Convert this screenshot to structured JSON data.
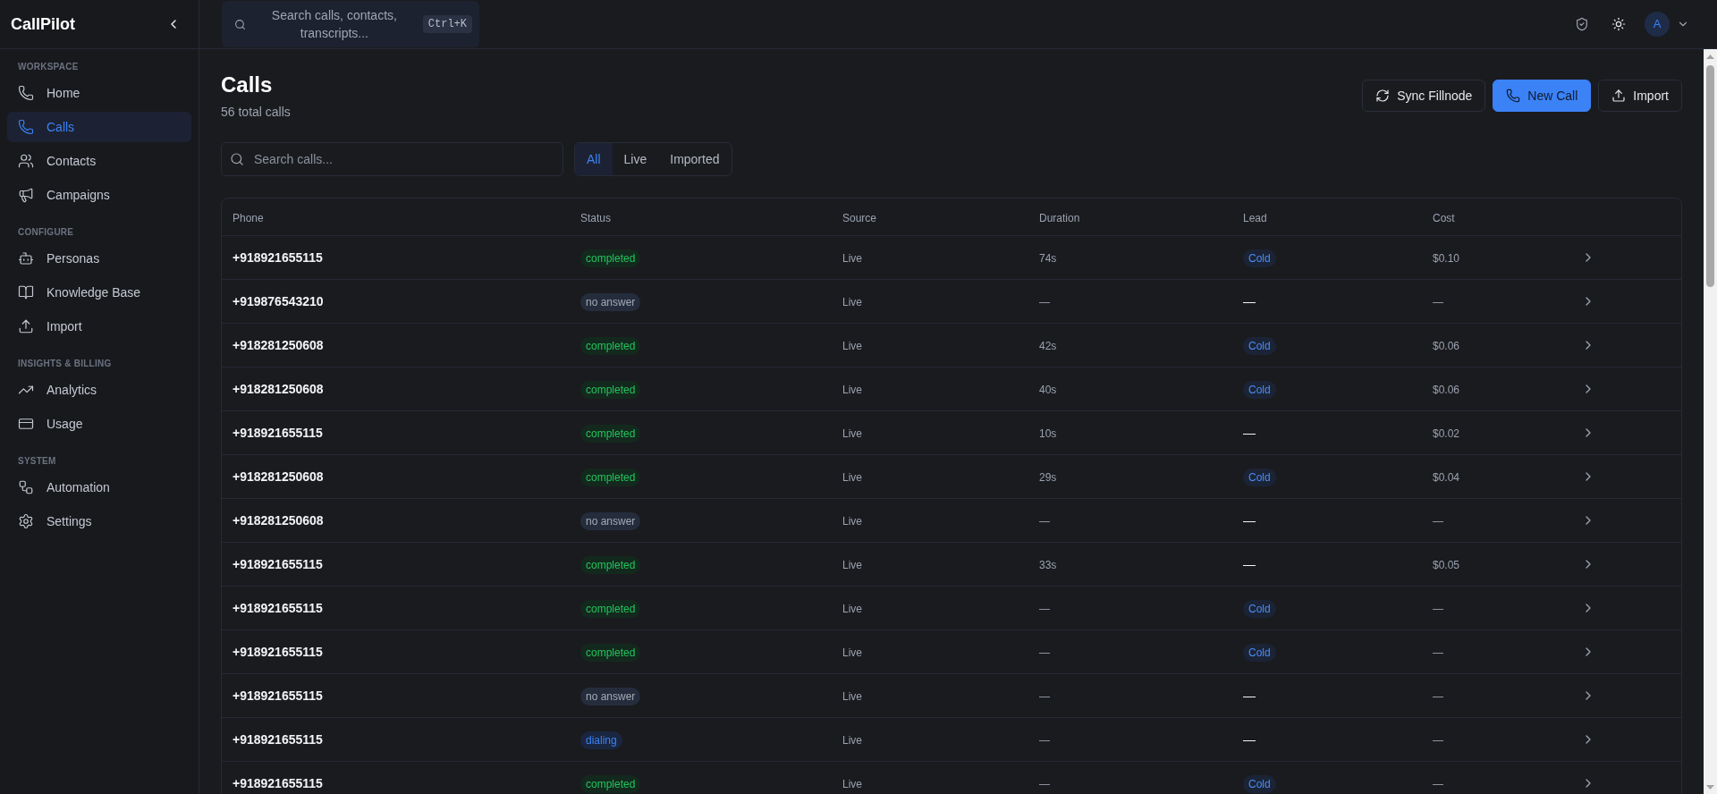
{
  "sidebar": {
    "brand": "CallPilot",
    "sections": [
      {
        "label": "WORKSPACE",
        "items": [
          {
            "label": "Home",
            "selected": false
          },
          {
            "label": "Calls",
            "selected": true
          },
          {
            "label": "Contacts",
            "selected": false
          },
          {
            "label": "Campaigns",
            "selected": false
          }
        ]
      },
      {
        "label": "CONFIGURE",
        "items": [
          {
            "label": "Personas",
            "selected": false
          },
          {
            "label": "Knowledge Base",
            "selected": false
          },
          {
            "label": "Import",
            "selected": false
          }
        ]
      },
      {
        "label": "INSIGHTS & BILLING",
        "items": [
          {
            "label": "Analytics",
            "selected": false
          },
          {
            "label": "Usage",
            "selected": false
          }
        ]
      },
      {
        "label": "SYSTEM",
        "items": [
          {
            "label": "Automation",
            "selected": false
          },
          {
            "label": "Settings",
            "selected": false
          }
        ]
      }
    ]
  },
  "topbar": {
    "search": {
      "label": "Search calls, contacts, transcripts...",
      "shortcut": "Ctrl+K"
    },
    "avatar": "A"
  },
  "header": {
    "title": "Calls",
    "subtitle": "56 total calls",
    "actions": [
      {
        "label": "Sync Fillnode",
        "kind": "outline"
      },
      {
        "label": "New Call",
        "kind": "primary"
      },
      {
        "label": "Import",
        "kind": "outline"
      }
    ]
  },
  "filters": {
    "search": {
      "placeholder": "Search calls..."
    },
    "tabs": [
      {
        "label": "All",
        "selected": true
      },
      {
        "label": "Live",
        "selected": false
      },
      {
        "label": "Imported",
        "selected": false
      }
    ]
  },
  "table": {
    "columns": [
      "Phone",
      "Status",
      "Source",
      "Duration",
      "Lead",
      "Cost"
    ],
    "rows": [
      {
        "phone": "+918921655115",
        "status": {
          "label": "completed",
          "kind": "success"
        },
        "source": "Live",
        "duration": "74s",
        "lead": {
          "label": "Cold",
          "kind": "tag"
        },
        "cost": "$0.10"
      },
      {
        "phone": "+919876543210",
        "status": {
          "label": "no answer",
          "kind": "neutral"
        },
        "source": "Live",
        "duration": "—",
        "lead": {
          "label": "—",
          "kind": "empty"
        },
        "cost": "—"
      },
      {
        "phone": "+918281250608",
        "status": {
          "label": "completed",
          "kind": "success"
        },
        "source": "Live",
        "duration": "42s",
        "lead": {
          "label": "Cold",
          "kind": "tag"
        },
        "cost": "$0.06"
      },
      {
        "phone": "+918281250608",
        "status": {
          "label": "completed",
          "kind": "success"
        },
        "source": "Live",
        "duration": "40s",
        "lead": {
          "label": "Cold",
          "kind": "tag"
        },
        "cost": "$0.06"
      },
      {
        "phone": "+918921655115",
        "status": {
          "label": "completed",
          "kind": "success"
        },
        "source": "Live",
        "duration": "10s",
        "lead": {
          "label": "—",
          "kind": "empty"
        },
        "cost": "$0.02"
      },
      {
        "phone": "+918281250608",
        "status": {
          "label": "completed",
          "kind": "success"
        },
        "source": "Live",
        "duration": "29s",
        "lead": {
          "label": "Cold",
          "kind": "tag"
        },
        "cost": "$0.04"
      },
      {
        "phone": "+918281250608",
        "status": {
          "label": "no answer",
          "kind": "neutral"
        },
        "source": "Live",
        "duration": "—",
        "lead": {
          "label": "—",
          "kind": "empty"
        },
        "cost": "—"
      },
      {
        "phone": "+918921655115",
        "status": {
          "label": "completed",
          "kind": "success"
        },
        "source": "Live",
        "duration": "33s",
        "lead": {
          "label": "—",
          "kind": "empty"
        },
        "cost": "$0.05"
      },
      {
        "phone": "+918921655115",
        "status": {
          "label": "completed",
          "kind": "success"
        },
        "source": "Live",
        "duration": "—",
        "lead": {
          "label": "Cold",
          "kind": "tag"
        },
        "cost": "—"
      },
      {
        "phone": "+918921655115",
        "status": {
          "label": "completed",
          "kind": "success"
        },
        "source": "Live",
        "duration": "—",
        "lead": {
          "label": "Cold",
          "kind": "tag"
        },
        "cost": "—"
      },
      {
        "phone": "+918921655115",
        "status": {
          "label": "no answer",
          "kind": "neutral"
        },
        "source": "Live",
        "duration": "—",
        "lead": {
          "label": "—",
          "kind": "empty"
        },
        "cost": "—"
      },
      {
        "phone": "+918921655115",
        "status": {
          "label": "dialing",
          "kind": "info"
        },
        "source": "Live",
        "duration": "—",
        "lead": {
          "label": "—",
          "kind": "empty"
        },
        "cost": "—"
      },
      {
        "phone": "+918921655115",
        "status": {
          "label": "completed",
          "kind": "success"
        },
        "source": "Live",
        "duration": "—",
        "lead": {
          "label": "Cold",
          "kind": "tag"
        },
        "cost": "—"
      }
    ]
  }
}
